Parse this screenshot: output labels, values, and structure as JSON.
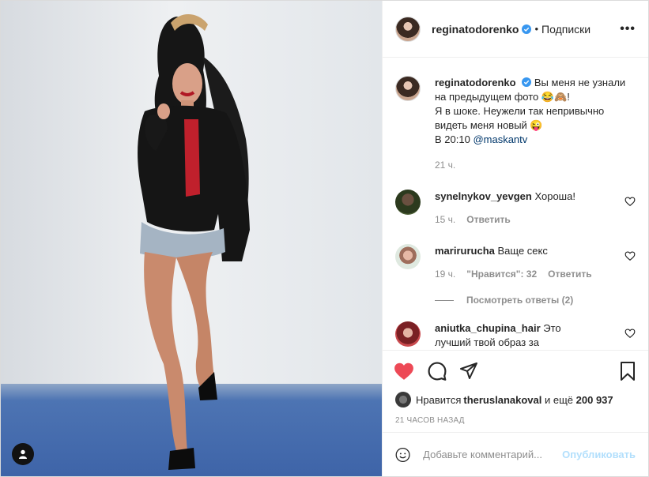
{
  "post": {
    "username": "reginatodorenko",
    "follow_label": "Подписки",
    "dot": "•",
    "more_label": "•••"
  },
  "caption": {
    "username": "reginatodorenko",
    "line1": " Вы меня не узнали на предыдущем фото 😂🙈!",
    "line2": "Я в шоке. Неужели так непривычно видеть меня новый 😜",
    "line3": "В 20:10 ",
    "mention": "@maskantv",
    "time": "21 ч."
  },
  "comments": [
    {
      "username": "synelnykov_yevgen",
      "text": " Хороша!",
      "time": "15 ч.",
      "reply_label": "Ответить",
      "likes": ""
    },
    {
      "username": "marirurucha",
      "text": " Ваще секс",
      "time": "19 ч.",
      "likes": "\"Нравится\": 32",
      "reply_label": "Ответить",
      "view_replies": "Посмотреть ответы (2)"
    },
    {
      "username": "aniutka_chupina_hair",
      "text": " Это лучший твой образ за"
    }
  ],
  "likes_row": {
    "prefix": "Нравится ",
    "user": "theruslanakoval",
    "suffix": " и ещё ",
    "count": "200 937"
  },
  "timestamp": "21 ЧАСОВ НАЗАД",
  "add_comment": {
    "placeholder": "Добавьте комментарий...",
    "publish_label": "Опубликовать"
  },
  "colors": {
    "heart": "#ed4956",
    "link": "#00376b",
    "verified": "#3897f0",
    "publish_disabled": "#b2dffc"
  }
}
